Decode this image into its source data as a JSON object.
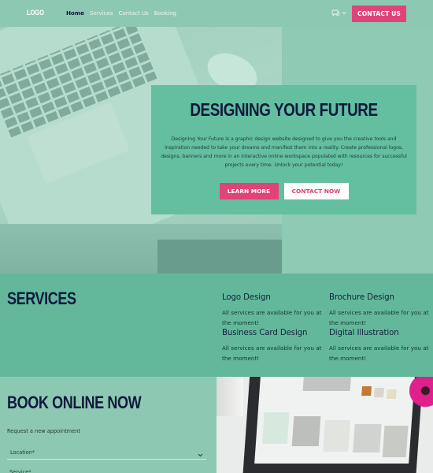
{
  "header": {
    "logo": "LOGO",
    "nav": [
      {
        "label": "Home",
        "active": true
      },
      {
        "label": "Services",
        "active": false
      },
      {
        "label": "Contact Us",
        "active": false
      },
      {
        "label": "Booking",
        "active": false
      }
    ],
    "language_icon": "chat-bubbles-icon",
    "language_dropdown_icon": "chevron-down-icon",
    "contact_button": "CONTACT US"
  },
  "hero": {
    "title": "DESIGNING YOUR FUTURE",
    "description": "Designing Your Future is a graphic design website designed to give you the creative tools and inspiration needed to take your dreams and manifest them into a reality. Create professional logos, designs, banners and more in an interactive online workspace populated with resources for successful projects every time. Unlock your potential today!",
    "learn_more_button": "LEARN MORE",
    "contact_now_button": "CONTACT NOW"
  },
  "services": {
    "title": "SERVICES",
    "items": [
      {
        "name": "Logo Design",
        "description": "All services are available for you at the moment!"
      },
      {
        "name": "Brochure Design",
        "description": "All services are available for you at the moment!"
      },
      {
        "name": "Business Card Design",
        "description": "All services are available for you at the moment!"
      },
      {
        "name": "Digital Illustration",
        "description": "All services are available for you at the moment!"
      }
    ]
  },
  "booking": {
    "title": "BOOK ONLINE NOW",
    "subtitle": "Request a new appointment",
    "location_label": "Location*",
    "service_label": "Service*"
  },
  "colors": {
    "background": "#8ECAB4",
    "card": "#63BFA0",
    "accent_pink": "#E0437A",
    "navy": "#0F1A3D"
  }
}
